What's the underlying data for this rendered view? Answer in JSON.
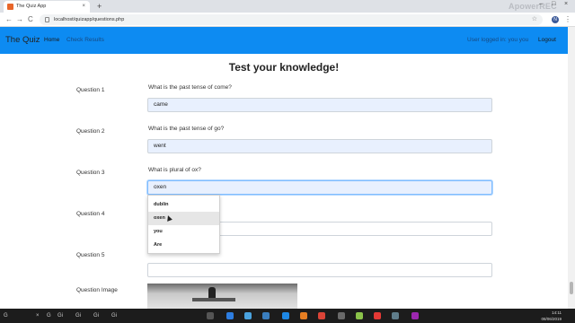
{
  "browser": {
    "tab_title": "The Quiz App",
    "tab_close": "×",
    "new_tab": "+",
    "watermark": "ApowerREC",
    "url": "localhost/quizapp/questions.php",
    "profile_initial": "N",
    "back": "←",
    "forward": "→",
    "reload": "C",
    "star": "☆",
    "menu": "⋮",
    "minimize": "–",
    "maximize": "□",
    "close": "×"
  },
  "navbar": {
    "brand": "The Quiz",
    "home": "Home",
    "check_results": "Check Results",
    "logged_in": "User logged in: you you",
    "logout": "Logout",
    "background": "#0d8bf2"
  },
  "main": {
    "title": "Test your knowledge!",
    "questions": [
      {
        "label": "Question 1",
        "text": "What is the past tense of come?",
        "answer": "came"
      },
      {
        "label": "Question 2",
        "text": "What is the past tense of go?",
        "answer": "went"
      },
      {
        "label": "Question 3",
        "text": "What is plural of ox?",
        "answer": "oxen"
      },
      {
        "label": "Question 4",
        "text": "",
        "answer": ""
      },
      {
        "label": "Question 5",
        "text": "",
        "answer": ""
      }
    ],
    "image_label": "Question Image"
  },
  "autocomplete": [
    "dublin",
    "oxen",
    "you",
    "Are"
  ],
  "taskbar": {
    "items": [
      "G",
      "×",
      "G",
      "Gi",
      "Gi",
      "Gi",
      "Gi"
    ],
    "time": "14:11",
    "date": "08/06/2019"
  }
}
